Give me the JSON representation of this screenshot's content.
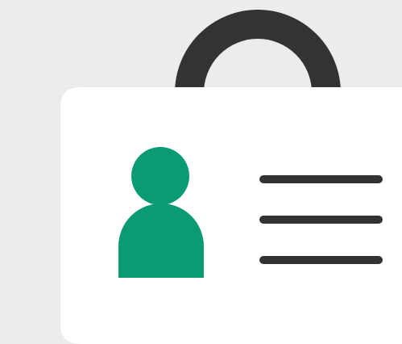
{
  "icon": {
    "name": "id-badge-icon",
    "parts": {
      "lanyard_clip": "lanyard-clip-icon",
      "person": "person-icon",
      "text_lines": "text-lines-icon"
    }
  },
  "colors": {
    "background": "#ececec",
    "card": "#ffffff",
    "clip": "#333333",
    "person": "#0a9a74",
    "lines": "#333333"
  }
}
